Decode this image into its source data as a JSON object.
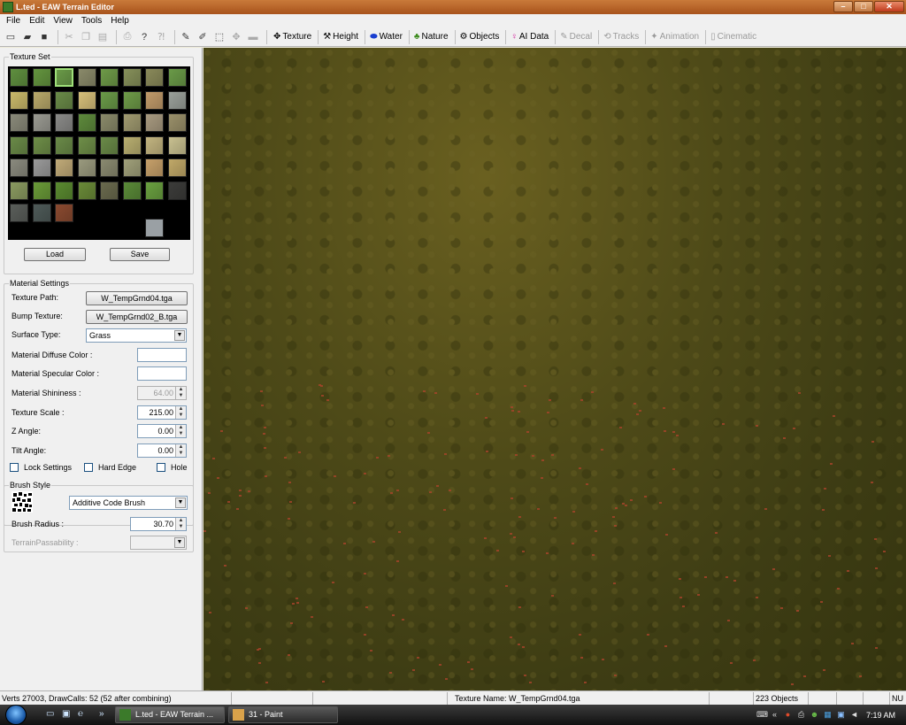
{
  "window": {
    "title": "L.ted - EAW Terrain Editor",
    "min": "–",
    "max": "□",
    "close": "✕"
  },
  "menu": [
    "File",
    "Edit",
    "View",
    "Tools",
    "Help"
  ],
  "toolbar": {
    "icons": [
      {
        "name": "new-icon",
        "glyph": "▭",
        "enabled": true
      },
      {
        "name": "open-icon",
        "glyph": "▰",
        "enabled": true
      },
      {
        "name": "save-icon",
        "glyph": "■",
        "enabled": true
      },
      {
        "name": "cut-icon",
        "glyph": "✂",
        "enabled": false
      },
      {
        "name": "copy-icon",
        "glyph": "❐",
        "enabled": false
      },
      {
        "name": "paste-icon",
        "glyph": "▤",
        "enabled": false
      },
      {
        "name": "print-icon",
        "glyph": "⎙",
        "enabled": false
      },
      {
        "name": "help-icon",
        "glyph": "?",
        "enabled": true
      },
      {
        "name": "context-help-icon",
        "glyph": "⁈",
        "enabled": false
      },
      {
        "name": "pencil-icon",
        "glyph": "✎",
        "enabled": true
      },
      {
        "name": "brush-icon",
        "glyph": "✐",
        "enabled": true
      },
      {
        "name": "select-icon",
        "glyph": "⬚",
        "enabled": true
      },
      {
        "name": "move-icon",
        "glyph": "✥",
        "enabled": false
      },
      {
        "name": "ruler-icon",
        "glyph": "▬",
        "enabled": false
      }
    ],
    "tabs": [
      {
        "label": "Texture",
        "icon": "✥",
        "icon_name": "texture-tab-icon",
        "enabled": true
      },
      {
        "label": "Height",
        "icon": "⚒",
        "icon_name": "height-tab-icon",
        "enabled": true
      },
      {
        "label": "Water",
        "icon": "⬬",
        "icon_name": "water-tab-icon",
        "enabled": true,
        "color": "#1a3fd0"
      },
      {
        "label": "Nature",
        "icon": "♣",
        "icon_name": "nature-tab-icon",
        "enabled": true,
        "color": "#3c8a1c"
      },
      {
        "label": "Objects",
        "icon": "⚙",
        "icon_name": "objects-tab-icon",
        "enabled": true
      },
      {
        "label": "AI Data",
        "icon": "♀",
        "icon_name": "ai-data-tab-icon",
        "enabled": true,
        "color": "#d0209a"
      },
      {
        "label": "Decal",
        "icon": "✎",
        "icon_name": "decal-tab-icon",
        "enabled": false
      },
      {
        "label": "Tracks",
        "icon": "⟲",
        "icon_name": "tracks-tab-icon",
        "enabled": false
      },
      {
        "label": "Animation",
        "icon": "✦",
        "icon_name": "animation-tab-icon",
        "enabled": false
      },
      {
        "label": "Cinematic",
        "icon": "▯",
        "icon_name": "cinematic-tab-icon",
        "enabled": false
      }
    ]
  },
  "texture_set": {
    "title": "Texture Set",
    "selected_index": 2,
    "swatches": [
      "#5f8f3f",
      "#64953f",
      "#6a9a48",
      "#8a8a6a",
      "#6e9a48",
      "#86905a",
      "#8a8a5a",
      "#6a9a48",
      "#c9b86a",
      "#b8a86a",
      "#6a8a48",
      "#d6bf7a",
      "#6a9a48",
      "#6e9a48",
      "#c09a6a",
      "#9aa09a",
      "#8a8a7a",
      "#9a9a92",
      "#8a8a88",
      "#5e8a3c",
      "#8a8a6a",
      "#a09a70",
      "#a89a80",
      "#9a906a",
      "#6a8a48",
      "#6e8e48",
      "#6a8a48",
      "#6e8e48",
      "#6a8a48",
      "#b8ae70",
      "#c2b480",
      "#c8c090",
      "#8a8a7e",
      "#9a9a9a",
      "#c0aa78",
      "#9a9a7e",
      "#8a8a70",
      "#a0a07a",
      "#c6a06a",
      "#c0a868",
      "#8a9a60",
      "#6a9a38",
      "#5a8a30",
      "#6a8a38",
      "#6a6a4e",
      "#5a8a38",
      "#6aa040",
      "#3c3c3a",
      "#5a5e5a",
      "#4e5a58",
      "#8a4a30"
    ],
    "extra_swatch": "#9aa0a4",
    "load_label": "Load",
    "save_label": "Save"
  },
  "material": {
    "title": "Material Settings",
    "texture_path_label": "Texture Path:",
    "texture_path": "W_TempGrnd04.tga",
    "bump_label": "Bump Texture:",
    "bump_texture": "W_TempGrnd02_B.tga",
    "surface_label": "Surface Type:",
    "surface_type": "Grass",
    "diffuse_label": "Material Diffuse Color :",
    "specular_label": "Material Specular Color :",
    "shininess_label": "Material Shininess :",
    "shininess": "64.00",
    "scale_label": "Texture Scale :",
    "scale": "215.00",
    "z_angle_label": "Z Angle:",
    "z_angle": "0.00",
    "tilt_label": "Tilt Angle:",
    "tilt": "0.00",
    "lock_label": "Lock Settings",
    "hard_edge_label": "Hard Edge",
    "hole_label": "Hole"
  },
  "brush": {
    "title": "Brush Style",
    "style": "Additive Code Brush",
    "radius_label": "Brush Radius :",
    "radius": "30.70",
    "passability_label": "TerrainPassability :"
  },
  "status": {
    "stats": "Verts 27003, DrawCalls: 52 (52 after combining)",
    "texture_name": "Texture Name: W_TempGrnd04.tga",
    "objects": "223 Objects",
    "mode": "NU"
  },
  "taskbar": {
    "tasks": [
      {
        "label": "L.ted - EAW Terrain ...",
        "active": true
      },
      {
        "label": "31 - Paint",
        "active": false
      }
    ],
    "clock": "7:19 AM",
    "chevron": "«",
    "ql_more": "»"
  },
  "colors": {
    "terrain": "#4e4a18",
    "selected_swatch_border": "#9fe07a"
  }
}
